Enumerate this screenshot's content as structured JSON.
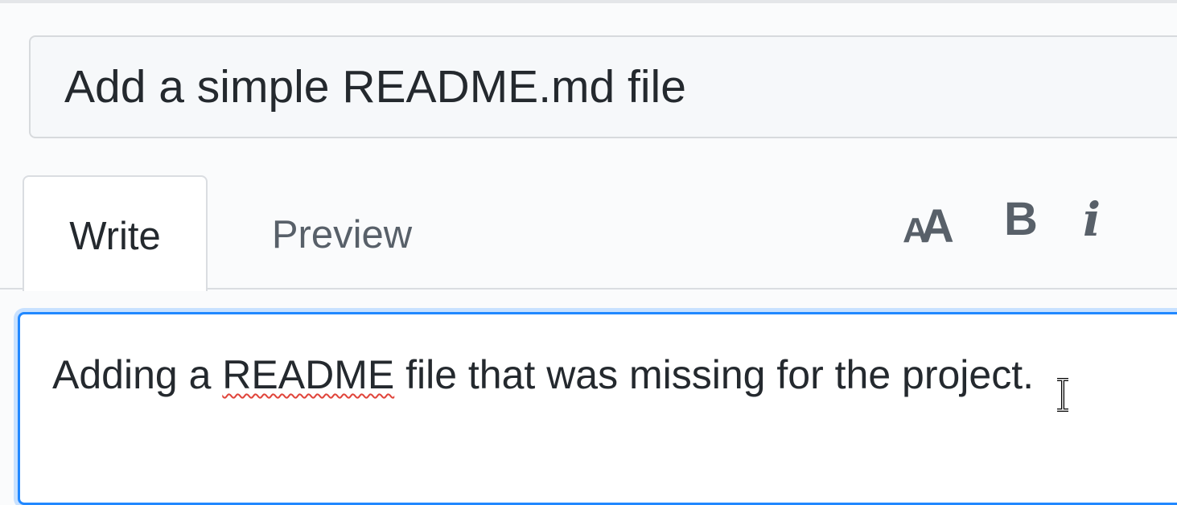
{
  "title_field": {
    "value": "Add a simple README.md file"
  },
  "tabs": [
    {
      "label": "Write",
      "active": true
    },
    {
      "label": "Preview",
      "active": false
    }
  ],
  "toolbar": {
    "heading_small": "A",
    "heading_big": "A",
    "bold_label": "B",
    "italic_label": "i"
  },
  "editor": {
    "text_before": "Adding a ",
    "text_misspelled": "README",
    "text_after": " file that was missing for the project."
  },
  "colors": {
    "focus_border": "#2188ff",
    "spellcheck_underline": "#e0443a"
  },
  "icons": {
    "mouse_cursor": "text-cursor-icon"
  }
}
